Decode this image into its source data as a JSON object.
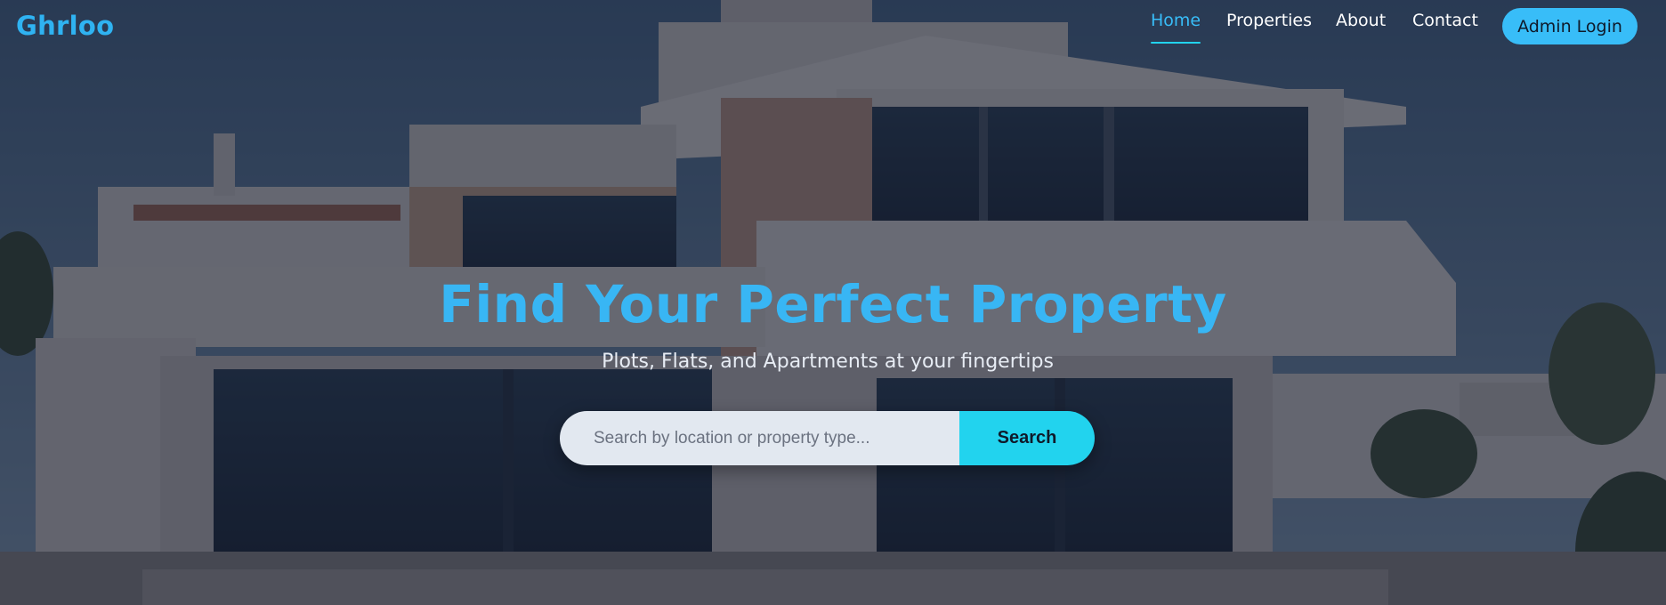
{
  "brand": {
    "name": "Ghrloo"
  },
  "nav": {
    "items": [
      {
        "label": "Home",
        "active": true
      },
      {
        "label": "Properties",
        "active": false
      },
      {
        "label": "About",
        "active": false
      },
      {
        "label": "Contact",
        "active": false
      }
    ],
    "admin_label": "Admin Login"
  },
  "hero": {
    "title": "Find Your Perfect Property",
    "subtitle": "Plots, Flats, and Apartments at your fingertips",
    "background_icon": "modern-villa-photo"
  },
  "search": {
    "placeholder": "Search by location or property type...",
    "value": "",
    "button_label": "Search"
  },
  "colors": {
    "brand": "#2fb3f2",
    "title": "#38b6f4",
    "nav_active": "#38bdf8",
    "nav_underline": "#22d3ee",
    "admin_button": "#38bdf8",
    "search_button": "#22d3ee",
    "search_field": "#e2e8f0",
    "overlay": "#11182c"
  }
}
